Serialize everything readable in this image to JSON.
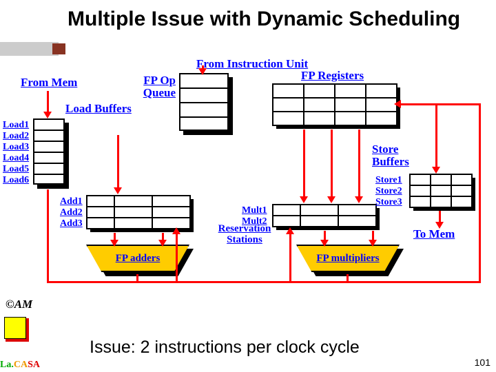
{
  "slide": {
    "title": "Multiple Issue with Dynamic Scheduling",
    "footer": "Issue: 2 instructions per clock cycle",
    "number": "101",
    "copyright": "©AM",
    "brand": "La.CASA"
  },
  "labels": {
    "from_instr_unit": "From Instruction Unit",
    "from_mem": "From Mem",
    "fp_op_queue": "FP Op\nQueue",
    "load_buffers": "Load Buffers",
    "fp_registers": "FP Registers",
    "store_buffers": "Store\nBuffers",
    "reservation_stations": "Reservation\nStations",
    "to_mem": "To Mem",
    "fp_adders": "FP adders",
    "fp_multipliers": "FP multipliers"
  },
  "load_buffers": [
    "Load1",
    "Load2",
    "Load3",
    "Load4",
    "Load5",
    "Load6"
  ],
  "add_rs": [
    "Add1",
    "Add2",
    "Add3"
  ],
  "mult_rs": [
    "Mult1",
    "Mult2"
  ],
  "store_buffers": [
    "Store1",
    "Store2",
    "Store3"
  ],
  "fp_reg_cols": 4,
  "fp_op_rows": 4,
  "rs_add_cols": 3,
  "rs_mult_cols": 3,
  "store_cols": 3
}
